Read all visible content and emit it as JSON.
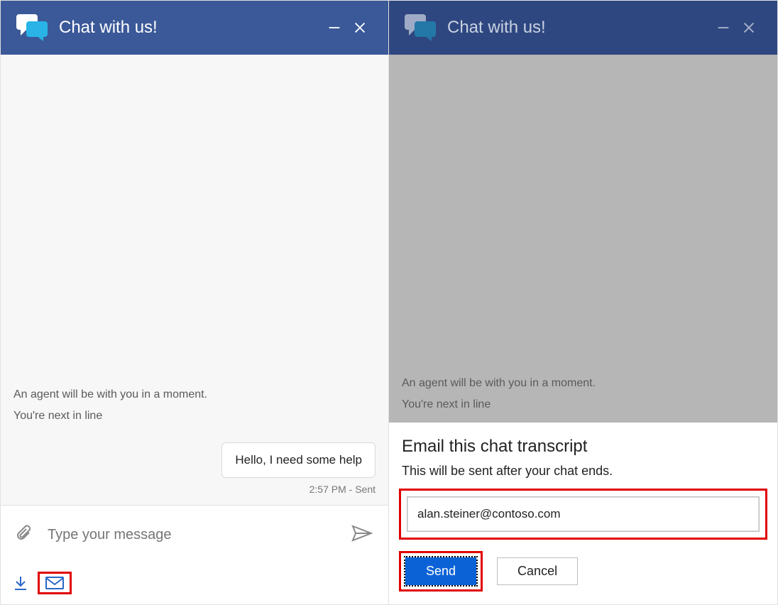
{
  "left": {
    "header": {
      "title": "Chat with us!"
    },
    "status1": "An agent will be with you in a moment.",
    "status2": "You're next in line",
    "message": "Hello, I need some help",
    "meta": "2:57 PM - Sent",
    "compose": {
      "placeholder": "Type your message"
    }
  },
  "right": {
    "header": {
      "title": "Chat with us!"
    },
    "status1": "An agent will be with you in a moment.",
    "status2": "You're next in line",
    "modal": {
      "title": "Email this chat transcript",
      "subtitle": "This will be sent after your chat ends.",
      "email_value": "alan.steiner@contoso.com",
      "send_label": "Send",
      "cancel_label": "Cancel"
    }
  }
}
